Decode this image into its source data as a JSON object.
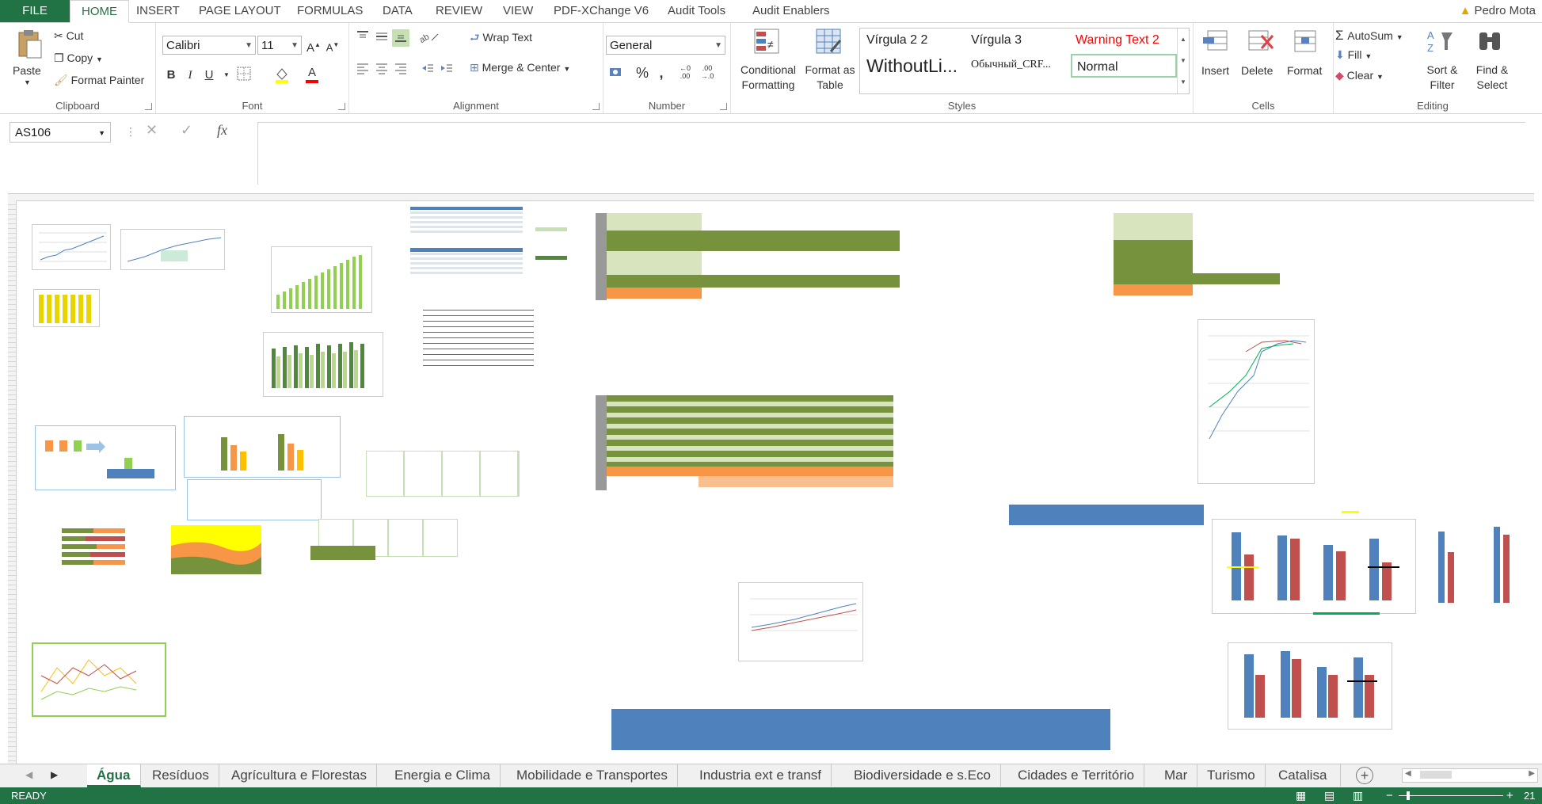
{
  "ribbon_tabs": [
    "FILE",
    "HOME",
    "INSERT",
    "PAGE LAYOUT",
    "FORMULAS",
    "DATA",
    "REVIEW",
    "VIEW",
    "PDF-XChange V6",
    "Audit Tools",
    "Audit Enablers"
  ],
  "user": "Pedro Mota",
  "clipboard": {
    "paste": "Paste",
    "cut": "Cut",
    "copy": "Copy",
    "format_painter": "Format Painter",
    "label": "Clipboard"
  },
  "font": {
    "name": "Calibri",
    "size": "11",
    "bold": "B",
    "italic": "I",
    "underline": "U",
    "label": "Font"
  },
  "alignment": {
    "wrap_text": "Wrap Text",
    "merge_center": "Merge & Center",
    "label": "Alignment"
  },
  "number": {
    "format": "General",
    "percent": "%",
    "comma": ",",
    "label": "Number"
  },
  "styles": {
    "conditional": "Conditional Formatting",
    "format_table": "Format as Table",
    "cells": [
      "Vírgula 2 2",
      "Vírgula 3",
      "Warning Text 2",
      "WithoutLi...",
      "Обычный_CRF...",
      "Normal"
    ],
    "label": "Styles"
  },
  "cells": {
    "insert": "Insert",
    "delete": "Delete",
    "format": "Format",
    "label": "Cells"
  },
  "editing": {
    "autosum": "AutoSum",
    "fill": "Fill",
    "clear": "Clear",
    "sort_filter": "Sort & Filter",
    "find_select": "Find & Select",
    "label": "Editing"
  },
  "name_box": "AS106",
  "formula_icons": {
    "cancel": "✕",
    "enter": "✓",
    "fx": "fx"
  },
  "sheet_tabs": [
    "Água",
    "Resíduos",
    "Agrícultura e Florestas",
    "Energia e Clima",
    "Mobilidade e Transportes",
    "Industria ext e transf",
    "Biodiversidade e s.Eco",
    "Cidades e Território",
    "Mar",
    "Turismo",
    "Catalisa"
  ],
  "active_sheet": "Água",
  "status": "READY",
  "zoom": "21",
  "colors": {
    "excel_green": "#217346",
    "dark_olive": "#76923c",
    "light_olive": "#d7e4bd",
    "orange": "#f79646",
    "blue": "#4f81bd",
    "red": "#c0504d"
  }
}
